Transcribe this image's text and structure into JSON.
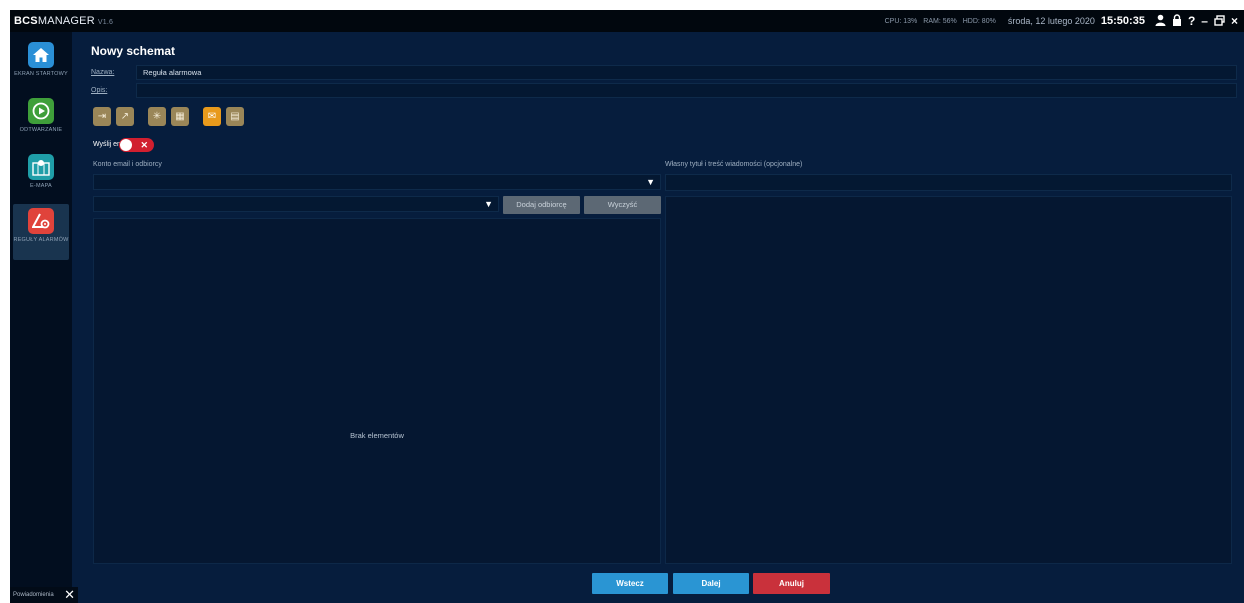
{
  "app": {
    "logo": "BCS",
    "name": "MANAGER",
    "version": "V1.6"
  },
  "status_bar": {
    "cpu": "CPU: 13%",
    "ram": "RAM: 56%",
    "hdd": "HDD: 80%",
    "date": "środa, 12 lutego 2020",
    "time": "15:50:35"
  },
  "sidebar": {
    "items": [
      {
        "label": "EKRAN STARTOWY",
        "icon": "home-icon",
        "color": "#2a8fd6"
      },
      {
        "label": "ODTWARZANIE",
        "icon": "play-icon",
        "color": "#3f9f3a"
      },
      {
        "label": "E-MAPA",
        "icon": "map-icon",
        "color": "#1f9ea8"
      },
      {
        "label": "REGUŁY ALARMÓW",
        "icon": "alarm-rule-icon",
        "color": "#e0433b"
      }
    ]
  },
  "form": {
    "title": "Nowy schemat",
    "name_label": "Nazwa:",
    "name_value": "Reguła alarmowa",
    "desc_label": "Opis:",
    "desc_value": "",
    "action_types": [
      {
        "icon": "input-icon",
        "selected": false
      },
      {
        "icon": "output-icon",
        "selected": false
      },
      {
        "icon": "siren-icon",
        "selected": false
      },
      {
        "icon": "preset-icon",
        "selected": false
      },
      {
        "icon": "email-icon",
        "selected": true
      },
      {
        "icon": "schedule-icon",
        "selected": false
      }
    ],
    "send_email_label": "Wyślij email",
    "send_email_enabled": false
  },
  "email": {
    "account_label": "Konto email i odbiorcy",
    "account_value": "",
    "recipient_value": "",
    "add_button": "Dodaj odbiorcę",
    "clear_button": "Wyczyść",
    "empty_text": "Brak elementów",
    "message_label": "Własny tytuł i treść wiadomości (opcjonalne)",
    "message_title": "",
    "message_body": ""
  },
  "footer": {
    "back": "Wstecz",
    "next": "Dalej",
    "cancel": "Anuluj",
    "notifications": "Powiadomienia"
  },
  "colors": {
    "background": "#061d3d",
    "back_button": "#2a95d3",
    "next_button": "#2a95d3",
    "cancel_button": "#c9313b",
    "toggle_off": "#d11f2f",
    "selected_type": "#e89a1c"
  }
}
